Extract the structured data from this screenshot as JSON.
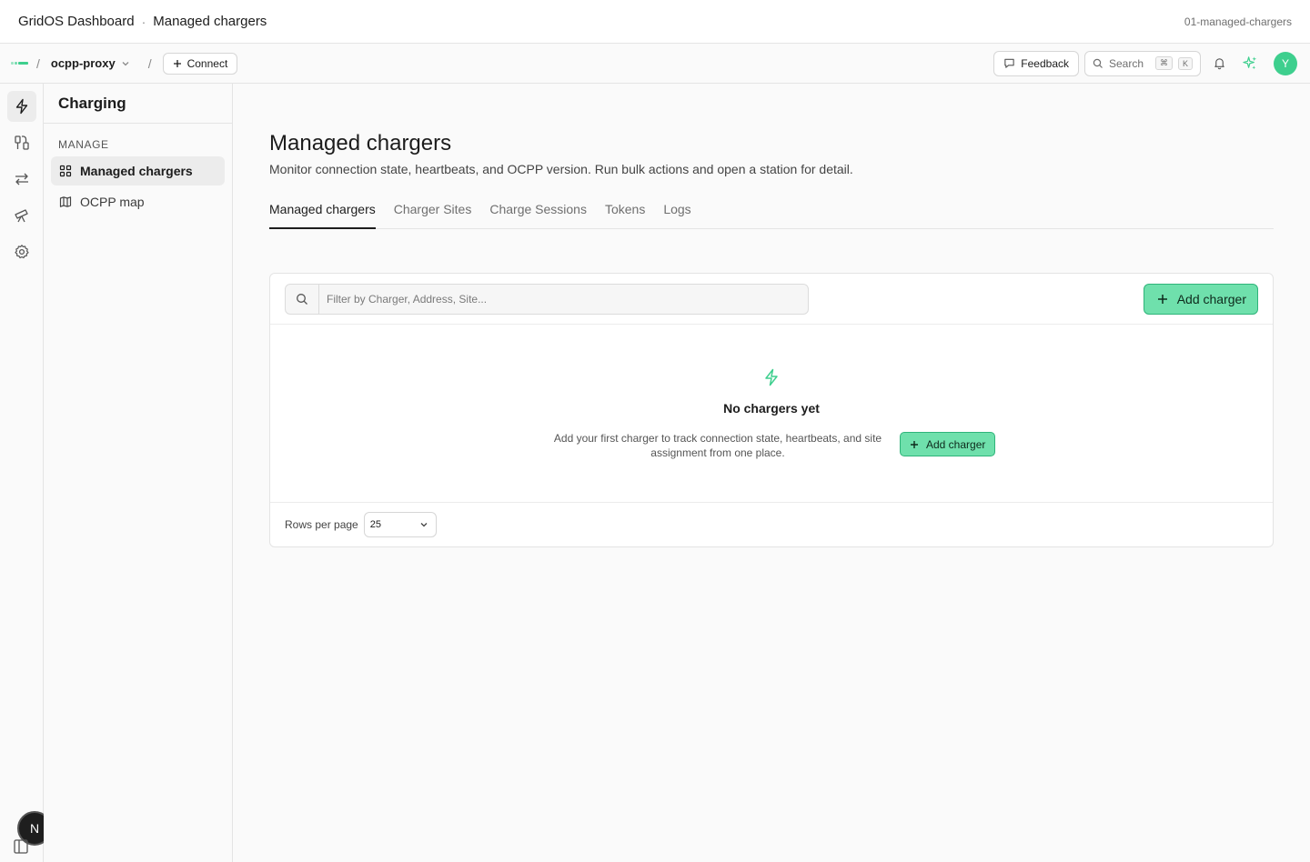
{
  "titlebar": {
    "app_name": "GridOS Dashboard",
    "separator": "·",
    "page_name": "Managed chargers",
    "slug": "01-managed-chargers"
  },
  "topnav": {
    "breadcrumb_sep": "/",
    "project_name": "ocpp-proxy",
    "connect_label": "Connect",
    "feedback_label": "Feedback",
    "search_label": "Search",
    "search_shortcut": [
      "⌘",
      "K"
    ],
    "avatar_initial": "Y"
  },
  "rail": {
    "items": [
      "charging-icon",
      "connectors-icon",
      "transfer-icon",
      "telescope-icon",
      "settings-icon"
    ],
    "active": "charging-icon",
    "bottom_badge": "N"
  },
  "sidebar": {
    "title": "Charging",
    "group_label": "MANAGE",
    "items": [
      {
        "label": "Managed chargers",
        "icon": "grid-icon",
        "active": true
      },
      {
        "label": "OCPP map",
        "icon": "map-icon",
        "active": false
      }
    ]
  },
  "main": {
    "title": "Managed chargers",
    "description": "Monitor connection state, heartbeats, and OCPP version. Run bulk actions and open a station for detail.",
    "tabs": [
      {
        "label": "Managed chargers",
        "active": true
      },
      {
        "label": "Charger Sites",
        "active": false
      },
      {
        "label": "Charge Sessions",
        "active": false
      },
      {
        "label": "Tokens",
        "active": false
      },
      {
        "label": "Logs",
        "active": false
      }
    ],
    "filter_placeholder": "Filter by Charger, Address, Site...",
    "add_button_label": "Add charger",
    "empty_state": {
      "title": "No chargers yet",
      "description": "Add your first charger to track connection state, heartbeats, and site assignment from one place.",
      "button_label": "Add charger"
    },
    "footer": {
      "rows_per_page_label": "Rows per page",
      "rows_per_page_value": "25"
    }
  },
  "colors": {
    "accent": "#3ecf8e",
    "button_fill": "#6fe0ac",
    "button_border": "#2fb47a"
  }
}
